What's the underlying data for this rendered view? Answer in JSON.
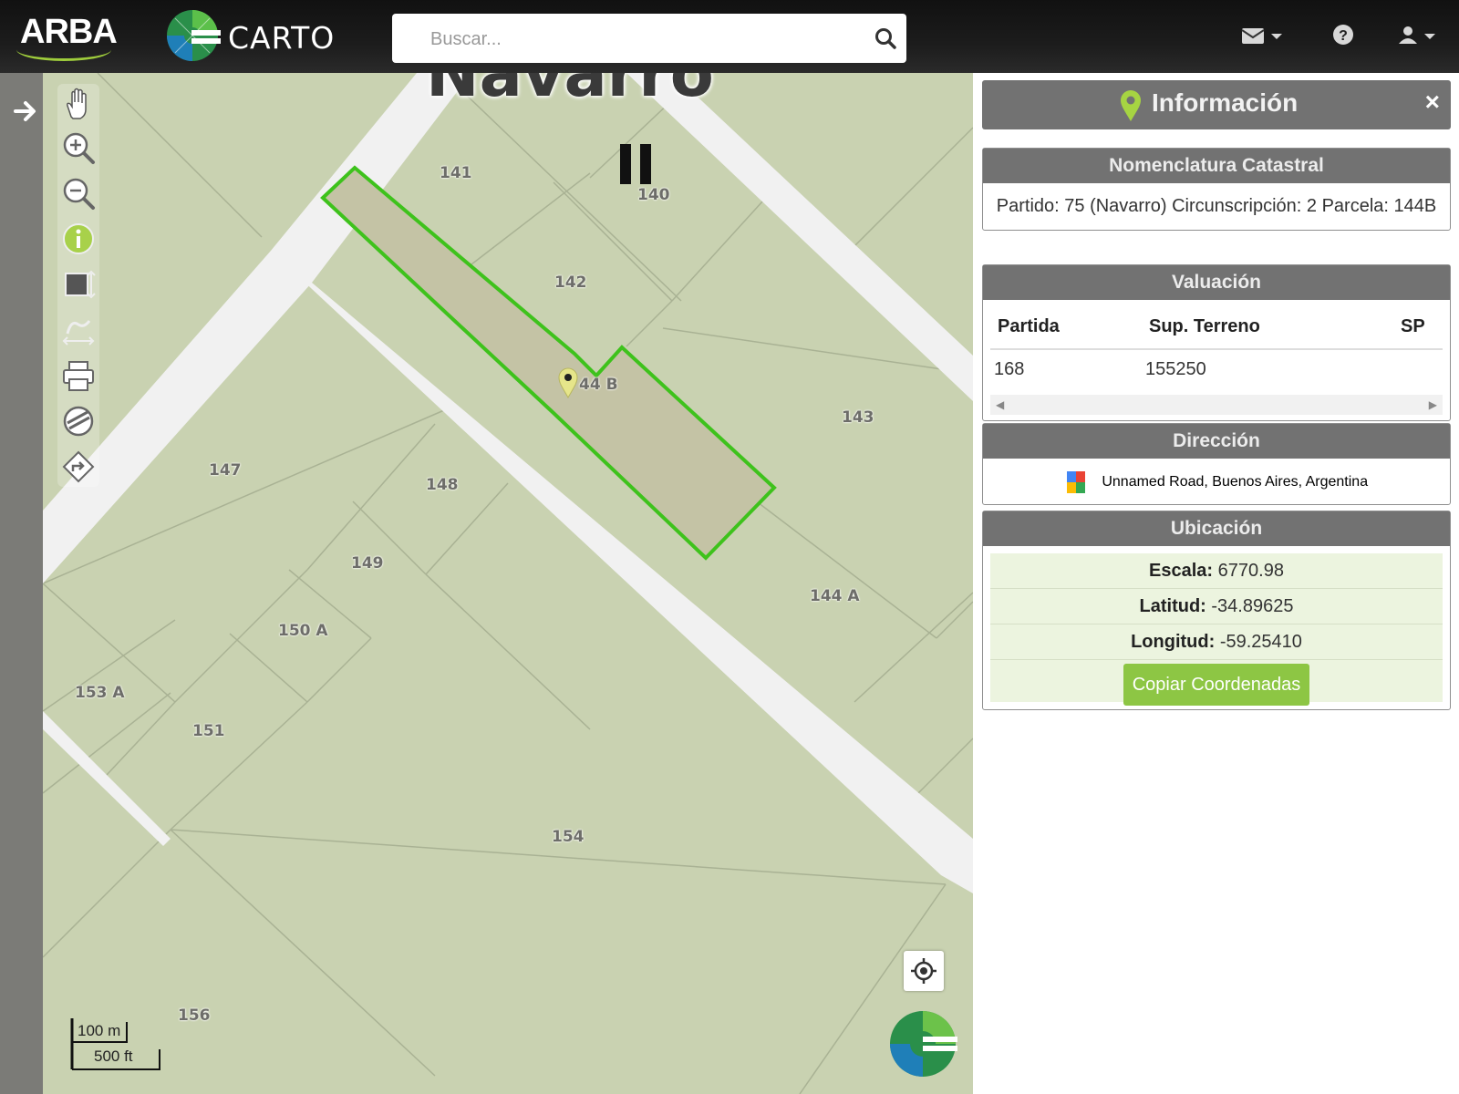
{
  "header": {
    "logo_arba": "ARBA",
    "logo_carto": "CARTO",
    "search_placeholder": "Buscar...",
    "icons": [
      "envelope-icon",
      "question-icon",
      "user-icon"
    ]
  },
  "map": {
    "town_label": "Navarro",
    "lots": [
      {
        "name": "lot-141",
        "label": "141"
      },
      {
        "name": "lot-140",
        "label": "140"
      },
      {
        "name": "lot-142",
        "label": "142"
      },
      {
        "name": "lot-144b",
        "label": "44 B"
      },
      {
        "name": "lot-143",
        "label": "143"
      },
      {
        "name": "lot-147",
        "label": "147"
      },
      {
        "name": "lot-148",
        "label": "148"
      },
      {
        "name": "lot-149",
        "label": "149"
      },
      {
        "name": "lot-150a",
        "label": "150 A"
      },
      {
        "name": "lot-144a",
        "label": "144 A"
      },
      {
        "name": "lot-153a",
        "label": "153 A"
      },
      {
        "name": "lot-151",
        "label": "151"
      },
      {
        "name": "lot-154",
        "label": "154"
      },
      {
        "name": "lot-156",
        "label": "156"
      }
    ],
    "scale_m": "100 m",
    "scale_ft": "500 ft",
    "toolbar": [
      "pan-hand-icon",
      "zoom-in-icon",
      "zoom-out-icon",
      "info-icon",
      "measure-area-icon",
      "measure-distance-icon",
      "print-icon",
      "layers-icon",
      "directions-icon"
    ],
    "colors": {
      "selected_outline": "#3ec21c",
      "parcel_fill": "#c9d2b1",
      "road": "#f2f2f2"
    }
  },
  "panel": {
    "title": "Información",
    "close": "×",
    "nomenclatura": {
      "header": "Nomenclatura Catastral",
      "text": "Partido: 75 (Navarro) Circunscripción: 2 Parcela: 144B"
    },
    "valuacion": {
      "header": "Valuación",
      "columns": [
        "Partida",
        "Sup. Terreno",
        "SP"
      ],
      "rows": [
        [
          "168",
          "155250",
          ""
        ]
      ]
    },
    "direccion": {
      "header": "Dirección",
      "address": "Unnamed Road, Buenos Aires, Argentina"
    },
    "ubicacion": {
      "header": "Ubicación",
      "escala_label": "Escala:",
      "escala_value": "6770.98",
      "latitud_label": "Latitud:",
      "latitud_value": "-34.89625",
      "longitud_label": "Longitud:",
      "longitud_value": "-59.25410",
      "copy_button": "Copiar Coordenadas"
    }
  }
}
